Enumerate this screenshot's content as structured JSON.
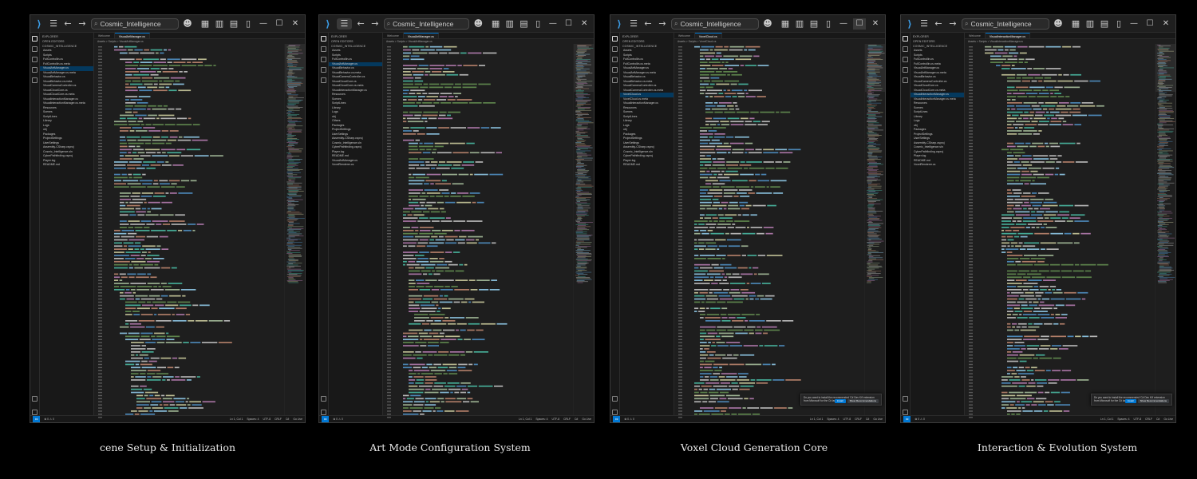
{
  "app": {
    "search_text": "Cosmic_Intelligence"
  },
  "windows": [
    {
      "id": "w1",
      "explorer_title": "EXPLORER",
      "open_editors_label": "OPEN EDITORS",
      "project_label": "COSMIC_INTELLIGENCE",
      "tabs": [
        "Welcome",
        "VisualArtManager.cs"
      ],
      "active_tab": 1,
      "breadcrumb": "Assets > Scripts > VisualArtManager.cs",
      "files": [
        "Assets",
        "Scripts",
        "FullControllin.cs",
        "FullControllin.cs.meta",
        "VisualArtManager.cs",
        "VisualArtManager.cs.meta",
        "VisualBehavior.cs",
        "VisualBehavior.cs.meta",
        "VisualCameraController.cs",
        "VisualCloudCore.cs",
        "VisualCloudCore.cs.meta",
        "VisualInteractionManager.cs",
        "VisualInteractionManager.cs.meta",
        "Resources",
        "Scenes",
        "ScriptLines",
        "Library",
        "Logs",
        "obj",
        "Packages",
        "ProjectSettings",
        "UserSettings",
        "Assembly-CSharp.csproj",
        "Cosmic_Intelligence.sln",
        "CyberPathfinding.csproj",
        "Player.log",
        "README.md"
      ],
      "selected_file": 4,
      "status_left": "⊗ 0 ⚠ 0",
      "status_right": [
        "Ln 1, Col 1",
        "Spaces: 4",
        "UTF-8",
        "CRLF",
        "C#",
        "Go Live"
      ],
      "toast": null
    },
    {
      "id": "w2",
      "explorer_title": "EXPLORER",
      "open_editors_label": "OPEN EDITORS",
      "project_label": "COSMIC_INTELLIGENCE",
      "tabs": [
        "Welcome",
        "VisualArtManager.cs"
      ],
      "active_tab": 1,
      "breadcrumb": "Assets > Scripts > VisualArtManager.cs",
      "files": [
        "Assets",
        "Scripts",
        "FullControllin.cs",
        "VisualArtManager.cs",
        "VisualBehavior.cs",
        "VisualBehavior.cs.meta",
        "VisualCameraController.cs",
        "VisualCloudCore.cs",
        "VisualCloudCore.cs.meta",
        "VisualInteractionManager.cs",
        "Resources",
        "Scenes",
        "ScriptLines",
        "Library",
        "Logs",
        "obj",
        "Others",
        "Packages",
        "ProjectSettings",
        "UserSettings",
        "Assembly-CSharp.csproj",
        "Cosmic_Intelligence.sln",
        "CyberPathfinding.csproj",
        "Player.log",
        "README.md",
        "VisualArtManager.cs",
        "VoxelRenderer.cs"
      ],
      "selected_file": 3,
      "status_left": "⊗ 0 ⚠ 0",
      "status_right": [
        "Ln 1, Col 1",
        "Spaces: 4",
        "UTF-8",
        "CRLF",
        "C#",
        "Go Live"
      ],
      "toast": null
    },
    {
      "id": "w3",
      "explorer_title": "EXPLORER",
      "open_editors_label": "OPEN EDITORS",
      "project_label": "COSMIC_INTELLIGENCE",
      "tabs": [
        "Welcome",
        "VoxelCloud.cs"
      ],
      "active_tab": 1,
      "breadcrumb": "Assets > Scripts > VoxelCloud.cs",
      "files": [
        "Assets",
        "Scripts",
        "FullControllin.cs",
        "FullControllin.cs.meta",
        "VisualArtManager.cs",
        "VisualArtManager.cs.meta",
        "VisualBehavior.cs",
        "VisualBehavior.cs.meta",
        "VisualCameraController.cs",
        "VisualCameraController.cs.meta",
        "VoxelCloud.cs",
        "VoxelCloud.cs.meta",
        "VisualInteractionManager.cs",
        "Resources",
        "Scenes",
        "ScriptLines",
        "Library",
        "Logs",
        "obj",
        "Packages",
        "ProjectSettings",
        "UserSettings",
        "Assembly-CSharp.csproj",
        "Cosmic_Intelligence.sln",
        "CyberPathfinding.csproj",
        "Player.log",
        "README.md"
      ],
      "selected_file": 10,
      "status_left": "⊗ 0 ⚠ 0",
      "status_right": [
        "Ln 1, Col 1",
        "Spaces: 4",
        "UTF-8",
        "CRLF",
        "C#",
        "Go Live"
      ],
      "toast": {
        "message": "Do you want to install the recommended 'C# Dev Kit' extension from Microsoft for the C# language?",
        "install_label": "Install",
        "show_label": "Show Recommendations"
      }
    },
    {
      "id": "w4",
      "explorer_title": "EXPLORER",
      "open_editors_label": "OPEN EDITORS",
      "project_label": "COSMIC_INTELLIGENCE",
      "tabs": [
        "Welcome",
        "VisualInteractionManager.cs"
      ],
      "active_tab": 1,
      "breadcrumb": "Assets > Scripts > VisualInteractionManager.cs",
      "files": [
        "Assets",
        "Scripts",
        "FullControllin.cs",
        "FullControllin.cs.meta",
        "VisualArtManager.cs",
        "VisualArtManager.cs.meta",
        "VisualBehavior.cs",
        "VisualCameraController.cs",
        "VisualCloudCore.cs",
        "VisualCloudCore.cs.meta",
        "VisualInteractionManager.cs",
        "VisualInteractionManager.cs.meta",
        "Resources",
        "Scenes",
        "ScriptLines",
        "Library",
        "Logs",
        "obj",
        "Packages",
        "ProjectSettings",
        "UserSettings",
        "Assembly-CSharp.csproj",
        "Cosmic_Intelligence.sln",
        "CyberPathfinding.csproj",
        "Player.log",
        "README.md",
        "VoxelRenderer.cs"
      ],
      "selected_file": 10,
      "status_left": "⊗ 0 ⚠ 0",
      "status_right": [
        "Ln 1, Col 1",
        "Spaces: 4",
        "UTF-8",
        "CRLF",
        "C#",
        "Go Live"
      ],
      "toast": {
        "message": "Do you want to install the recommended 'C# Dev Kit' extension from Microsoft for the C# language?",
        "install_label": "Install",
        "show_label": "Show Recommendations"
      }
    }
  ],
  "captions": [
    "cene Setup & Initialization",
    "Art Mode Configuration System",
    "Voxel Cloud Generation Core",
    "Interaction & Evolution System"
  ],
  "colors": {
    "accent": "#0078d4",
    "keyword": "#569cd6",
    "type": "#4ec9b0",
    "string": "#ce9178",
    "comment": "#6a9955",
    "method": "#dcdcaa",
    "variable": "#9cdcfe",
    "plain": "#d4d4d4",
    "control": "#c586c0",
    "number": "#b5cea8"
  }
}
